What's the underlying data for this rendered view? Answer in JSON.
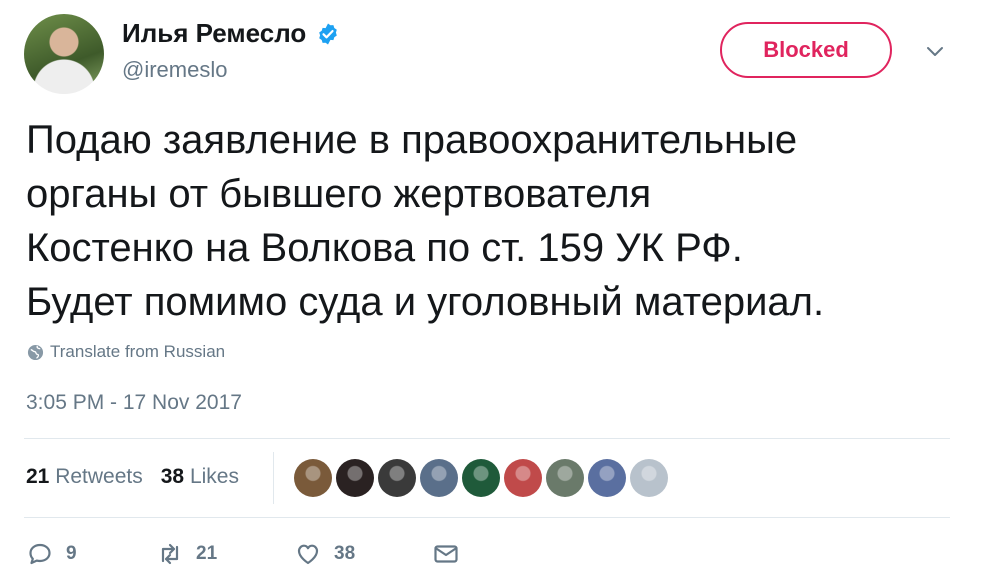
{
  "user": {
    "display_name": "Илья Ремесло",
    "handle": "@iremeslo",
    "verified_icon": "verified-badge-icon"
  },
  "block_button": {
    "label": "Blocked",
    "color": "#e0245e"
  },
  "tweet": {
    "text": "Подаю заявление в правоохранительные\nорганы от бывшего жертвователя\nКостенко на Волкова по ст. 159 УК РФ.\nБудет помимо суда и уголовный материал.",
    "translate_label": "Translate from Russian",
    "timestamp": "3:05 PM - 17 Nov 2017"
  },
  "stats": {
    "retweets_count": "21",
    "retweets_label": "Retweets",
    "likes_count": "38",
    "likes_label": "Likes"
  },
  "liker_avatars": [
    {
      "color": "#7a5a3a"
    },
    {
      "color": "#2a2222"
    },
    {
      "color": "#3a3a3a"
    },
    {
      "color": "#5a6f8a"
    },
    {
      "color": "#1f5a3a"
    },
    {
      "color": "#c04a4a"
    },
    {
      "color": "#6a7a6a"
    },
    {
      "color": "#5a6fa0"
    },
    {
      "color": "#b8c2cc"
    }
  ],
  "actions": {
    "reply_count": "9",
    "retweet_count": "21",
    "like_count": "38"
  },
  "colors": {
    "text_primary": "#14171a",
    "text_secondary": "#657786",
    "accent": "#1da1f2"
  }
}
